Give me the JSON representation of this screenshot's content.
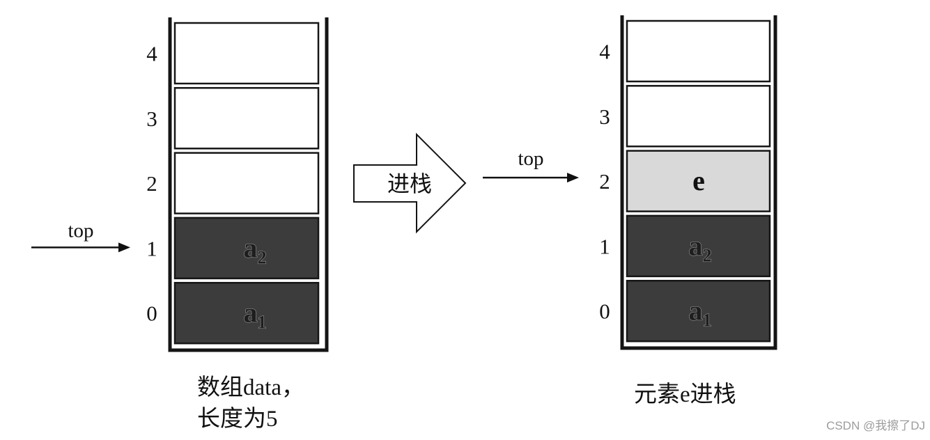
{
  "colors": {
    "line": "#141414",
    "watermark": "#9c9c9c"
  },
  "stack_before": {
    "top_label": "top",
    "top_index": 1,
    "cells": [
      {
        "index": "4",
        "fill": "#ffffff"
      },
      {
        "index": "3",
        "fill": "#ffffff"
      },
      {
        "index": "2",
        "fill": "#ffffff"
      },
      {
        "index": "1",
        "fill": "#3c3c3c",
        "value": "a",
        "sub": "2"
      },
      {
        "index": "0",
        "fill": "#3c3c3c",
        "value": "a",
        "sub": "1"
      }
    ],
    "caption_lines": [
      "数组data，",
      "长度为5"
    ]
  },
  "push_arrow": {
    "label": "进栈"
  },
  "stack_after": {
    "top_label": "top",
    "top_index": 2,
    "cells": [
      {
        "index": "4",
        "fill": "#ffffff"
      },
      {
        "index": "3",
        "fill": "#ffffff"
      },
      {
        "index": "2",
        "fill": "#d9d9d9",
        "value": "e"
      },
      {
        "index": "1",
        "fill": "#3c3c3c",
        "value": "a",
        "sub": "2"
      },
      {
        "index": "0",
        "fill": "#3c3c3c",
        "value": "a",
        "sub": "1"
      }
    ],
    "caption_lines": [
      "元素e进栈"
    ]
  },
  "watermark": "CSDN @我擦了DJ"
}
